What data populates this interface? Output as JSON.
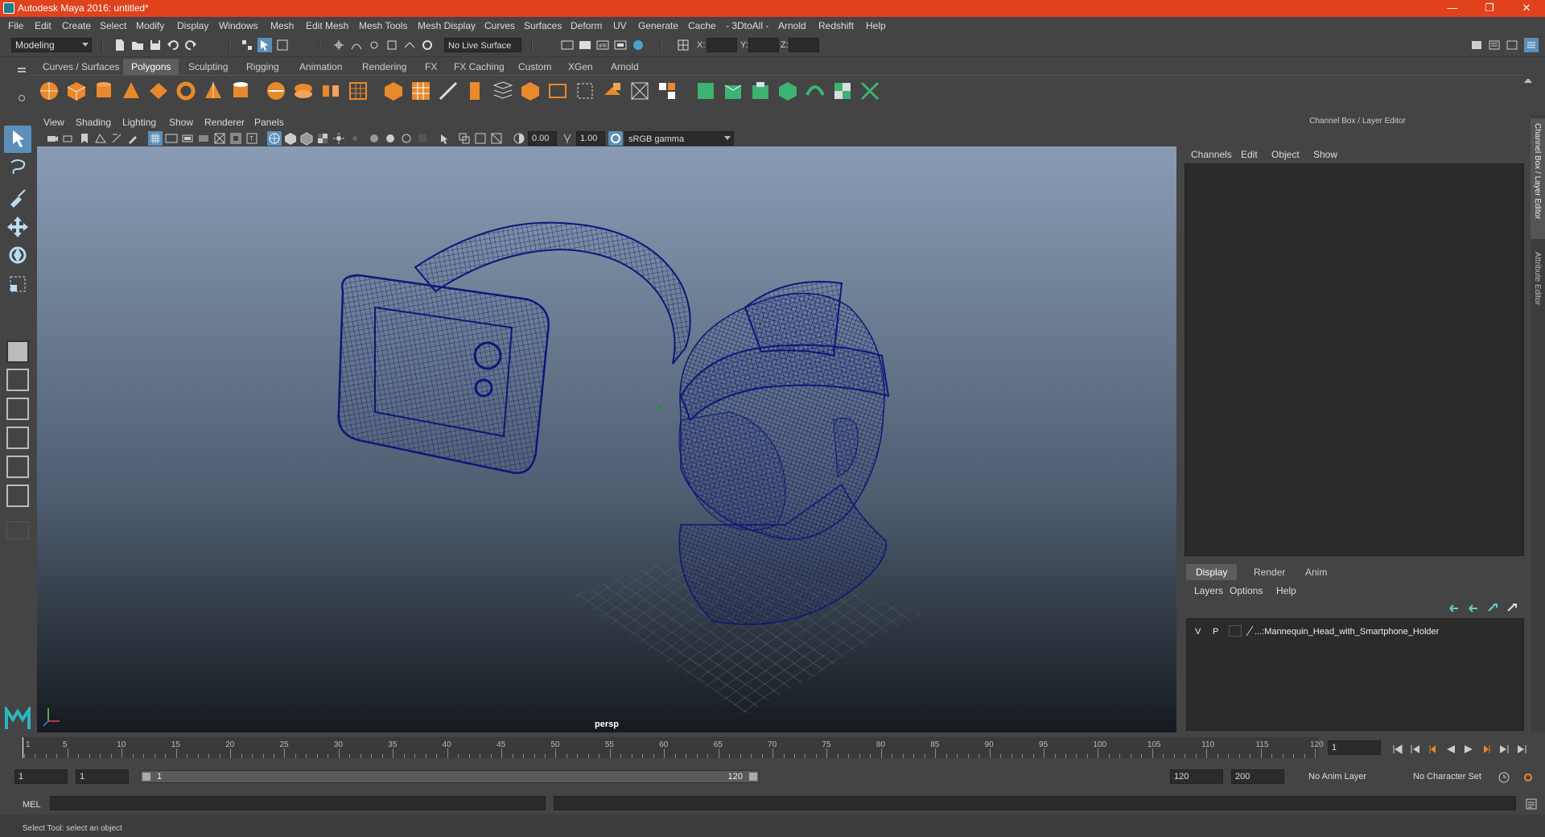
{
  "window": {
    "title": "Autodesk Maya 2016: untitled*"
  },
  "menubar": [
    "File",
    "Edit",
    "Create",
    "Select",
    "Modify",
    "Display",
    "Windows",
    "Mesh",
    "Edit Mesh",
    "Mesh Tools",
    "Mesh Display",
    "Curves",
    "Surfaces",
    "Deform",
    "UV",
    "Generate",
    "Cache",
    "- 3DtoAll -",
    "Arnold",
    "Redshift",
    "Help"
  ],
  "statusline": {
    "mode": "Modeling",
    "live_surface": "No Live Surface",
    "x_label": "X:",
    "y_label": "Y:",
    "z_label": "Z:"
  },
  "shelf": {
    "tabs": [
      "Curves / Surfaces",
      "Polygons",
      "Sculpting",
      "Rigging",
      "Animation",
      "Rendering",
      "FX",
      "FX Caching",
      "Custom",
      "XGen",
      "Arnold"
    ],
    "active_tab": "Polygons"
  },
  "viewport": {
    "menu": [
      "View",
      "Shading",
      "Lighting",
      "Show",
      "Renderer",
      "Panels"
    ],
    "exposure": "0.00",
    "gamma": "1.00",
    "color_space": "sRGB gamma",
    "camera": "persp",
    "wire_color": "#0f1678"
  },
  "channel_box": {
    "header": "Channel Box / Layer Editor",
    "menu": [
      "Channels",
      "Edit",
      "Object",
      "Show"
    ],
    "side_tabs": [
      "Channel Box / Layer Editor",
      "Attribute Editor"
    ]
  },
  "layer_editor": {
    "tabs": [
      "Display",
      "Render",
      "Anim"
    ],
    "active_tab": "Display",
    "menu": [
      "Layers",
      "Options",
      "Help"
    ],
    "layers": [
      {
        "visible": "V",
        "playback": "P",
        "name": "...:Mannequin_Head_with_Smartphone_Holder"
      }
    ]
  },
  "time_slider": {
    "labels": [
      "1",
      "5",
      "10",
      "15",
      "20",
      "25",
      "30",
      "35",
      "40",
      "45",
      "50",
      "55",
      "60",
      "65",
      "70",
      "75",
      "80",
      "85",
      "90",
      "95",
      "100",
      "105",
      "110",
      "115",
      "120"
    ],
    "current_frame": "1"
  },
  "range_slider": {
    "start": "1",
    "playback_start": "1",
    "slider_start": "1",
    "slider_end": "120",
    "playback_end": "120",
    "end": "200",
    "anim_layer": "No Anim Layer",
    "character_set": "No Character Set"
  },
  "command_line": {
    "label": "MEL"
  },
  "help_line": {
    "text": "Select Tool: select an object"
  },
  "colors": {
    "accent": "#5b8fb9",
    "titlebar": "#e0421d",
    "shelf_green": "#3cb371"
  }
}
